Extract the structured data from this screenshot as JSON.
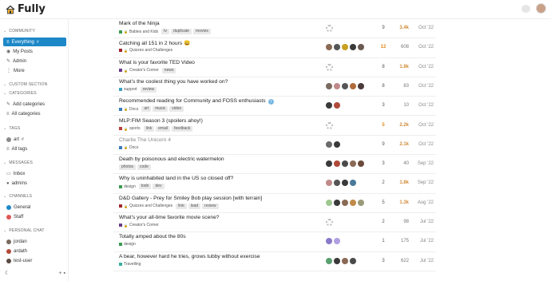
{
  "app": {
    "title": "Fully"
  },
  "sidebar": {
    "community": {
      "label": "COMMUNITY",
      "items": [
        {
          "label": "Everything",
          "active": true,
          "icon": "stack-icon"
        },
        {
          "label": "My Posts",
          "icon": "user-icon"
        },
        {
          "label": "Admin",
          "icon": "wrench-icon"
        },
        {
          "label": "More",
          "icon": "ellipsis-icon"
        }
      ]
    },
    "custom_section": {
      "label": "CUSTOM SECTION"
    },
    "categories": {
      "label": "CATEGORIES",
      "items": [
        {
          "label": "Add categories",
          "icon": "pencil-icon"
        },
        {
          "label": "All categories",
          "icon": "list-icon"
        }
      ]
    },
    "tags": {
      "label": "TAGS",
      "items": [
        {
          "label": "art",
          "icon": "tag-icon",
          "color": "#8a8a8a"
        },
        {
          "label": "All tags",
          "icon": "list-icon"
        }
      ]
    },
    "messages": {
      "label": "MESSAGES",
      "items": [
        {
          "label": "Inbox",
          "icon": "inbox-icon"
        },
        {
          "label": "admins",
          "icon": "group-icon"
        }
      ]
    },
    "channels": {
      "label": "CHANNELS",
      "items": [
        {
          "label": "General",
          "icon": "channel-icon",
          "color": "#1d88c8"
        },
        {
          "label": "Staff",
          "icon": "channel-icon",
          "color": "#e05555"
        }
      ]
    },
    "personal_chat": {
      "label": "PERSONAL CHAT",
      "items": [
        {
          "label": "jordan",
          "color": "#7a6a60"
        },
        {
          "label": "ardath",
          "color": "#b04a3a"
        },
        {
          "label": "test-user",
          "color": "#5a4a42"
        }
      ]
    }
  },
  "topics": [
    {
      "title": "Mark of the Ninja",
      "category": "Babies and Kids",
      "cat_color": "#3a9a52",
      "locked": true,
      "tags": [
        "tv",
        "duplicate",
        "movies"
      ],
      "posters": [
        "gear"
      ],
      "replies": "9",
      "views": "3.4k",
      "views_hot": true,
      "activity": "Oct '22"
    },
    {
      "title": "Catching all 151 in 2 hours 😄",
      "category": "Quizzes and Challenges",
      "cat_color": "#a0282d",
      "locked": true,
      "tags": [],
      "posters": [
        "#8a6a55",
        "#555555",
        "#c8a020",
        "#3a3a3a",
        "#6a5a50"
      ],
      "replies": "12",
      "replies_hot": true,
      "views": "608",
      "activity": "Oct '22"
    },
    {
      "title": "What is your favorite TED Video",
      "category": "Creator's Corner",
      "cat_color": "#6a3a8a",
      "locked": true,
      "tags": [
        "news"
      ],
      "posters": [
        "gear"
      ],
      "replies": "8",
      "views": "1.8k",
      "views_hot": true,
      "activity": "Oct '22"
    },
    {
      "title": "What’s the coolest thing you have worked on?",
      "category": "support",
      "cat_color": "#3aa0c0",
      "locked": false,
      "tags": [
        "review"
      ],
      "posters": [
        "#7a6a60",
        "#c08a8a",
        "#555555",
        "#b06a3a",
        "#4a3a3a"
      ],
      "replies": "8",
      "views": "83",
      "activity": "Oct '22"
    },
    {
      "title": "Recommended reading for Community and FOSS enthusiasts",
      "category": "Docs",
      "cat_color": "#3a7ac0",
      "locked": true,
      "tags": [
        "art",
        "music",
        "video"
      ],
      "posters": [
        "#3a3a3a",
        "#b04a3a"
      ],
      "replies": "3",
      "views": "10",
      "activity": "Oct '22",
      "pinned": true
    },
    {
      "title": "MLP:FIM Season 3 (spoilers ahoy!)",
      "category": "sports",
      "cat_color": "#c03a3a",
      "locked": true,
      "tags": [
        "link",
        "email",
        "feedback"
      ],
      "posters": [
        "gear"
      ],
      "replies": "5",
      "replies_hot": true,
      "views": "2.2k",
      "views_hot": true,
      "activity": "Oct '22"
    },
    {
      "title": "Charlie The Unicorn 4",
      "category": "Docs",
      "cat_color": "#3a7ac0",
      "locked": true,
      "tags": [],
      "posters": [
        "#6a6a6a",
        "#3a3a3a"
      ],
      "replies": "9",
      "views": "2.1k",
      "views_hot": true,
      "activity": "Oct '22",
      "muted": true
    },
    {
      "title": "Death by poisonous and electric watermelon",
      "category": "",
      "tags": [
        "photos",
        "code"
      ],
      "posters": [
        "#3a3a3a",
        "#b04a3a",
        "#4a4a4a",
        "#8a6a55",
        "#6a4a3a"
      ],
      "replies": "3",
      "views": "40",
      "activity": "Sep '22"
    },
    {
      "title": "Why is uninhabited land in the US so closed off?",
      "category": "design",
      "cat_color": "#3a9a52",
      "locked": false,
      "tags": [
        "todo",
        "dev"
      ],
      "posters": [
        "#c08a8a",
        "#555555",
        "#3a3a3a",
        "#4a7a9a"
      ],
      "replies": "2",
      "views": "1.8k",
      "views_hot": true,
      "activity": "Sep '22"
    },
    {
      "title": "D&D Gallery - Prey for Smiley Bob play session [with terrain]",
      "category": "Quizzes and Challenges",
      "cat_color": "#a0282d",
      "locked": true,
      "tags": [
        "link",
        "lead",
        "review"
      ],
      "posters": [
        "#a0c890",
        "#3a3a3a",
        "#8a6a55",
        "#c08a4a",
        "#9a9a7a"
      ],
      "replies": "5",
      "views": "1.3k",
      "views_hot": true,
      "activity": "Aug '22"
    },
    {
      "title": "What’s your all-time favorite movie scene?",
      "category": "Creator's Corner",
      "cat_color": "#6a3a8a",
      "locked": true,
      "tags": [],
      "posters": [
        "gear"
      ],
      "replies": "2",
      "views": "98",
      "activity": "Jul '22"
    },
    {
      "title": "Totally amped about the 80s",
      "category": "design",
      "cat_color": "#3a9a52",
      "locked": false,
      "tags": [],
      "posters": [
        "#8a7ac8",
        "#b0a0e0"
      ],
      "replies": "1",
      "views": "175",
      "activity": "Jul '22"
    },
    {
      "title": "A bear, however hard he tries, grows tubby without exercise",
      "category": "Travelling",
      "cat_color": "#3ab0a0",
      "locked": false,
      "tags": [],
      "posters": [
        "#5aa070",
        "#3a3a3a",
        "#8a6a55",
        "#4a4a4a"
      ],
      "replies": "3",
      "views": "622",
      "activity": "Jul '22"
    }
  ]
}
